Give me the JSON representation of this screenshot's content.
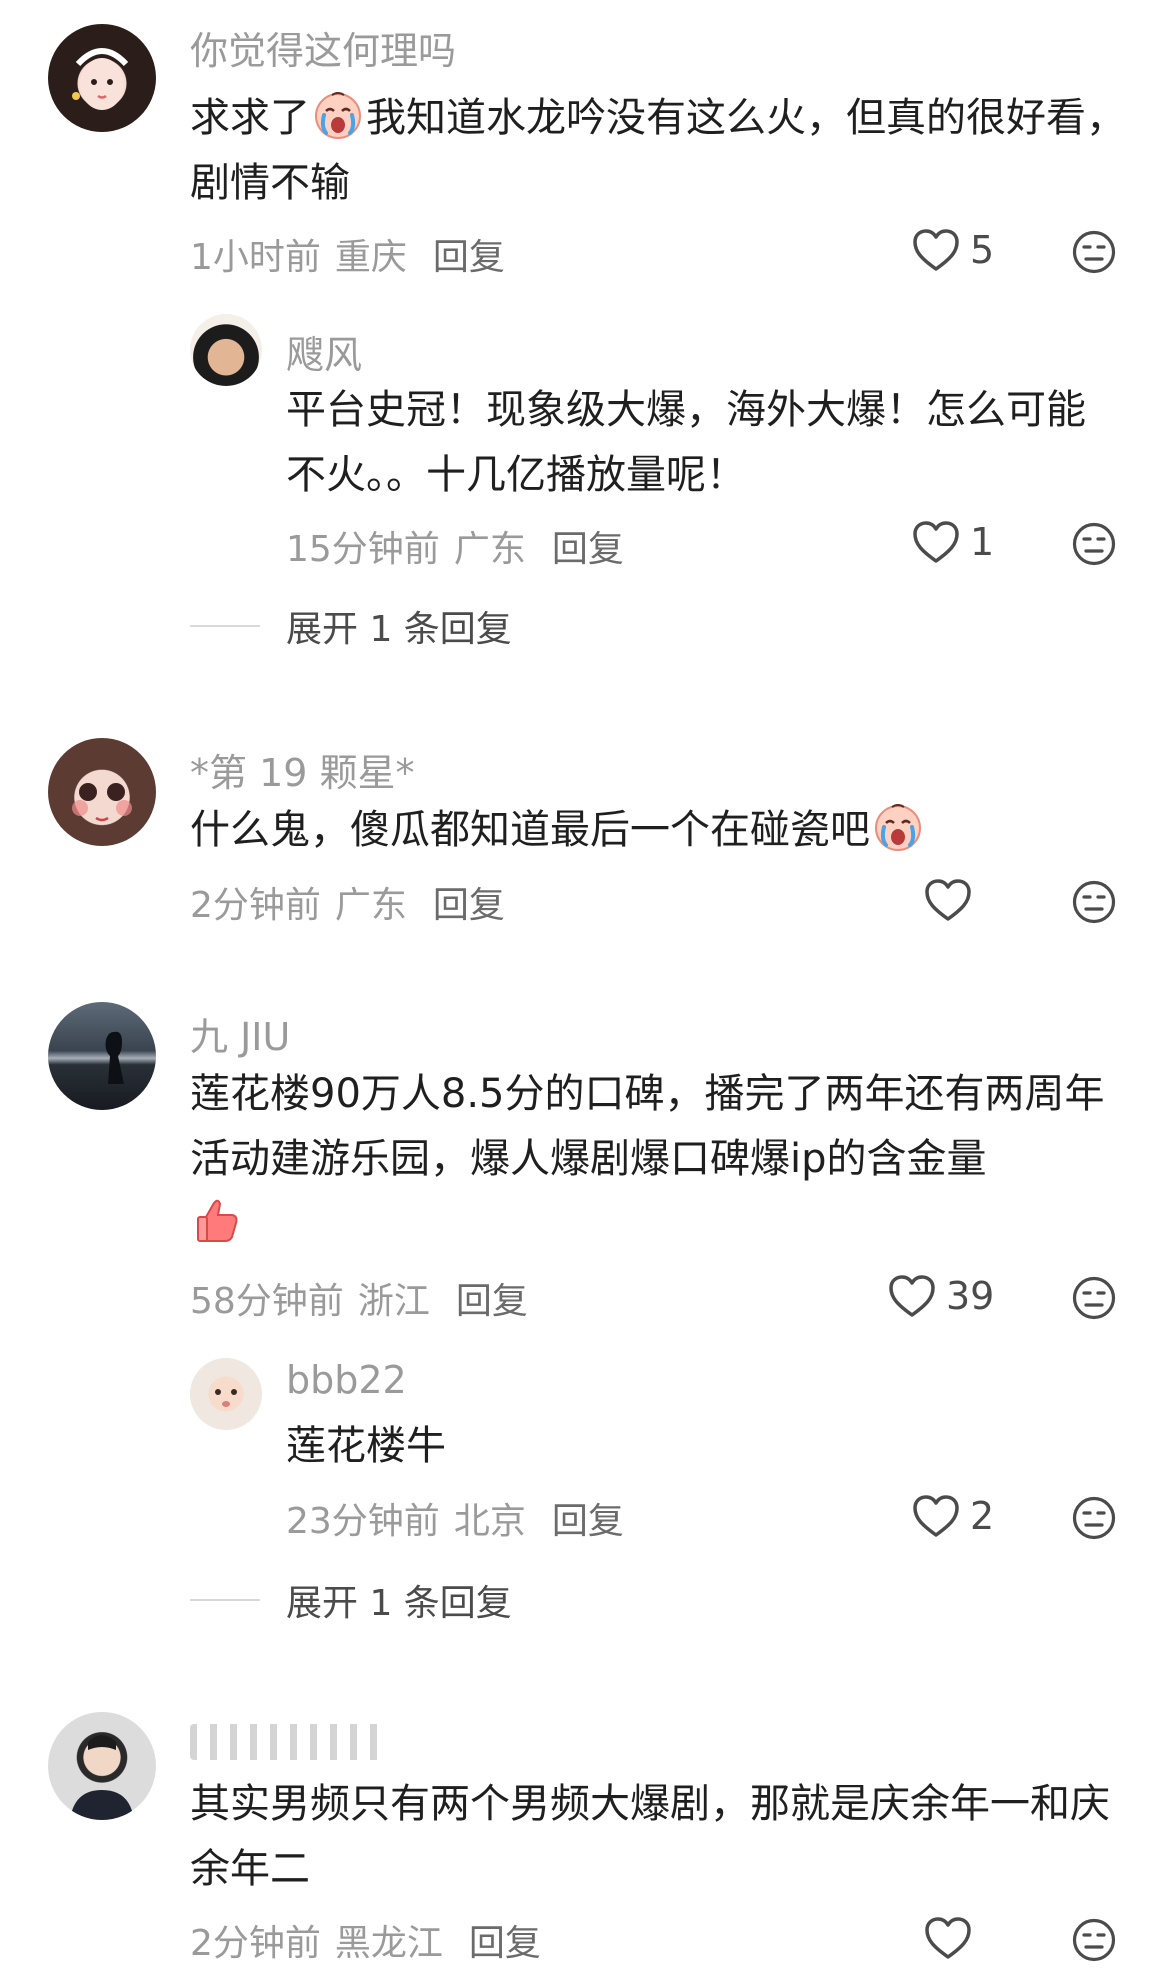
{
  "comments": [
    {
      "user": "你觉得这何理吗",
      "text_before": "求求了",
      "text_after": "我知道水龙吟没有这么火，但真的很好看，剧情不输",
      "time": "1小时前",
      "location": "重庆",
      "reply": "回复",
      "likes": "5",
      "replies": [
        {
          "user": "飕风",
          "text": "平台史冠！现象级大爆，海外大爆！怎么可能不火。。十几亿播放量呢！",
          "time": "15分钟前",
          "location": "广东",
          "reply": "回复",
          "likes": "1"
        }
      ],
      "expand": "展开 1 条回复"
    },
    {
      "user": "*第 19 颗星*",
      "text": "什么鬼，傻瓜都知道最后一个在碰瓷吧",
      "time": "2分钟前",
      "location": "广东",
      "reply": "回复",
      "likes": ""
    },
    {
      "user": "九 JIU",
      "text": "莲花楼90万人8.5分的口碑，播完了两年还有两周年活动建游乐园，爆人爆剧爆口碑爆ip的含金量",
      "time": "58分钟前",
      "location": "浙江",
      "reply": "回复",
      "likes": "39",
      "replies": [
        {
          "user": "bbb22",
          "text": "莲花楼牛",
          "time": "23分钟前",
          "location": "北京",
          "reply": "回复",
          "likes": "2"
        }
      ],
      "expand": "展开 1 条回复"
    },
    {
      "user": "",
      "text": "其实男频只有两个男频大爆剧，那就是庆余年一和庆余年二",
      "time": "2分钟前",
      "location": "黑龙江",
      "reply": "回复",
      "likes": ""
    }
  ],
  "icons": {
    "like": "heart-outline-icon",
    "dislike": "unhappy-face-icon",
    "crying_emoji": "crying-face-emoji",
    "thumb_emoji": "thumbs-up-emoji"
  },
  "colors": {
    "username": "#9a9a9a",
    "text": "#1f1f1f",
    "meta": "#9a9a9a",
    "icon": "#4b4b4b"
  }
}
